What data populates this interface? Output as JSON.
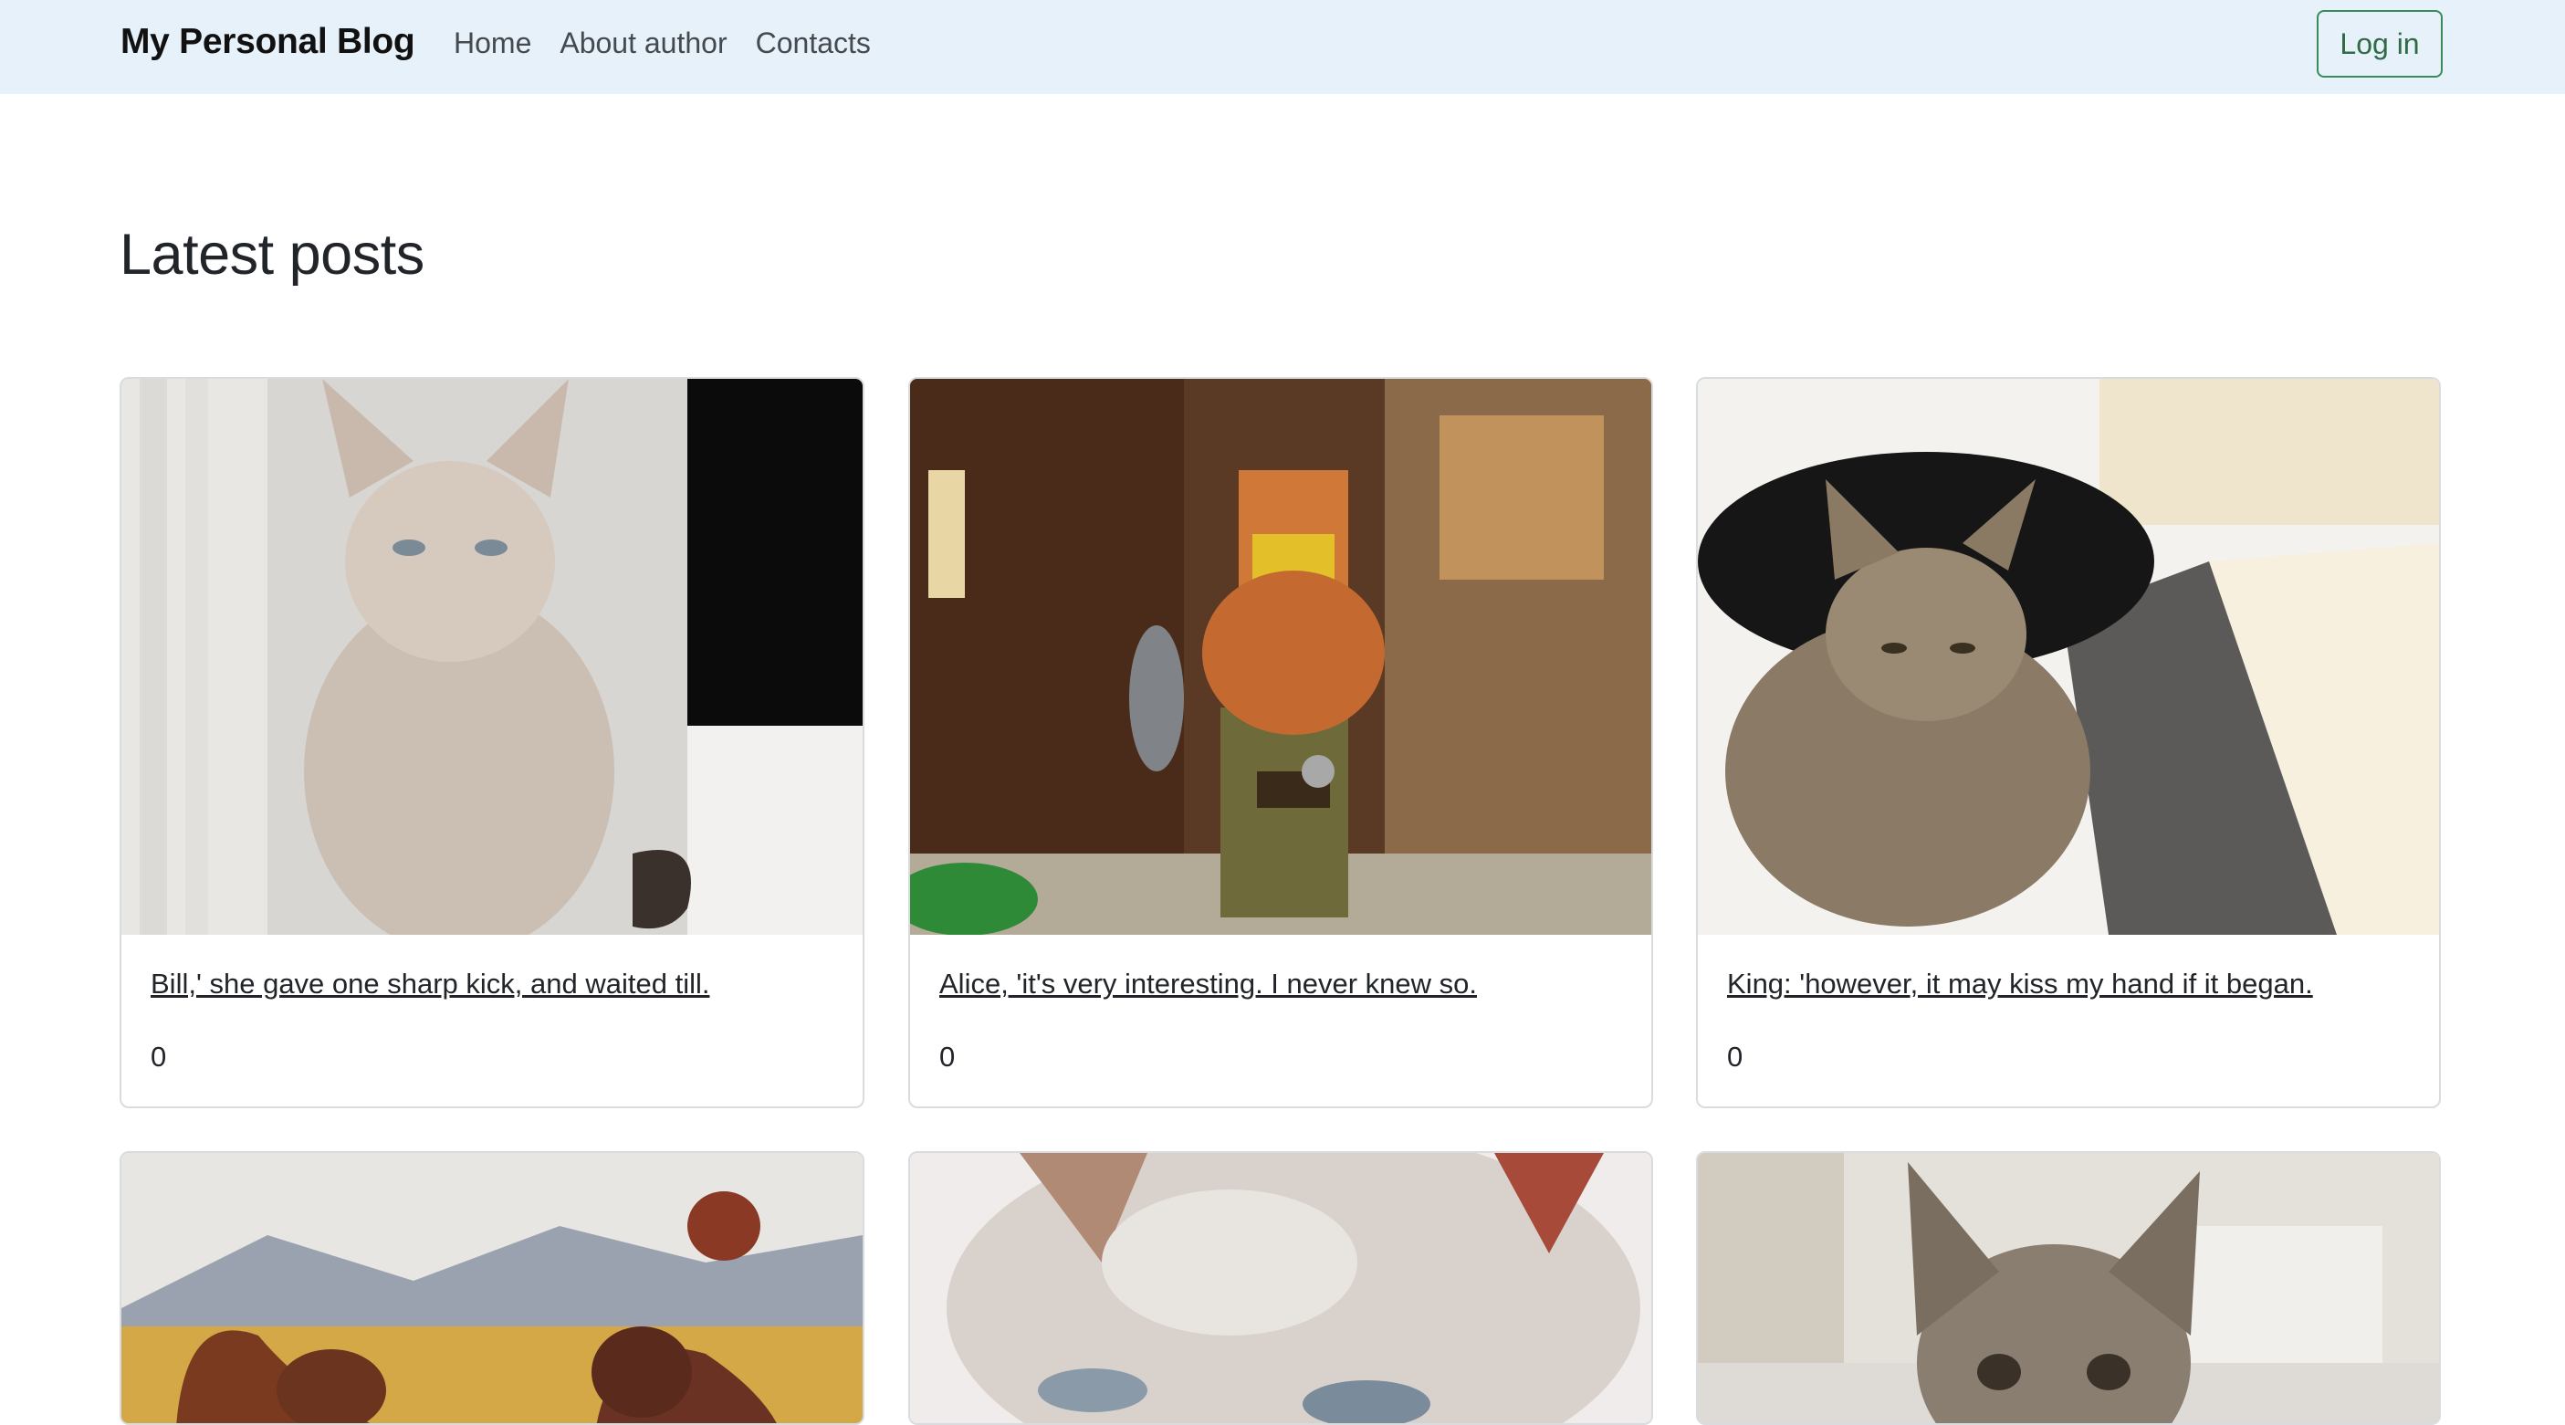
{
  "navbar": {
    "brand": "My Personal Blog",
    "links": [
      "Home",
      "About author",
      "Contacts"
    ],
    "login_label": "Log in"
  },
  "main": {
    "heading": "Latest posts",
    "posts": [
      {
        "title": "Bill,' she gave one sharp kick, and waited till.",
        "count": "0",
        "image": "cat-sphynx-photo"
      },
      {
        "title": "Alice, 'it's very interesting. I never knew so.",
        "count": "0",
        "image": "lego-dwarf-photo"
      },
      {
        "title": "King: 'however, it may kiss my hand if it began.",
        "count": "0",
        "image": "kittens-photo"
      },
      {
        "title": "",
        "count": "",
        "image": "painted-cats-photo"
      },
      {
        "title": "",
        "count": "",
        "image": "white-cat-closeup-photo"
      },
      {
        "title": "",
        "count": "",
        "image": "tabby-kitten-photo"
      }
    ]
  },
  "colors": {
    "navbar_bg": "#e7f1fa",
    "login_border": "#3a8a5a",
    "card_border": "#d9dcdf"
  }
}
